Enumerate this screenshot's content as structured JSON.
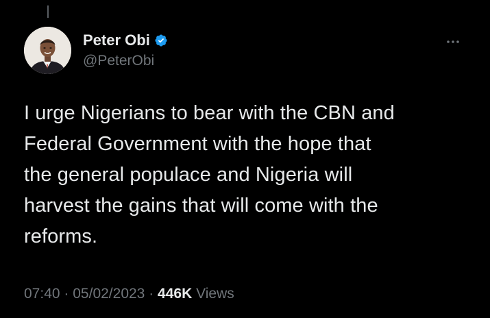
{
  "tweet": {
    "author": {
      "display_name": "Peter Obi",
      "handle": "@PeterObi",
      "verified": true,
      "avatar_icon": "profile-photo"
    },
    "text": "I urge Nigerians to bear with the CBN and\nFederal Government with the hope that\nthe general populace and Nigeria will\nharvest the gains that will come with the\nreforms.",
    "time": "07:40",
    "separator": "·",
    "date": "05/02/2023",
    "views_count": "446K",
    "views_label": "Views"
  },
  "icons": {
    "more": "more-options-icon",
    "verified": "verified-badge-icon"
  },
  "colors": {
    "background": "#000000",
    "primary_text": "#e7e9ea",
    "secondary_text": "#71767b",
    "verified_blue": "#1d9bf0"
  }
}
